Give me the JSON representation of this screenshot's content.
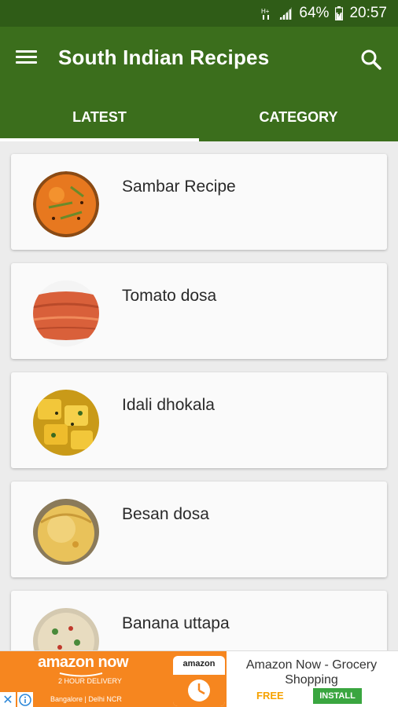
{
  "status_bar": {
    "battery": "64%",
    "time": "20:57"
  },
  "app": {
    "title": "South Indian Recipes"
  },
  "tabs": [
    {
      "label": "LATEST",
      "active": true
    },
    {
      "label": "CATEGORY",
      "active": false
    }
  ],
  "recipes": [
    {
      "name": "Sambar Recipe",
      "image": "sambar"
    },
    {
      "name": "Tomato dosa",
      "image": "tomato-dosa"
    },
    {
      "name": "Idali dhokala",
      "image": "idli-dhokla"
    },
    {
      "name": "Besan dosa",
      "image": "besan-dosa"
    },
    {
      "name": "Banana uttapa",
      "image": "banana-uttapam"
    }
  ],
  "ad": {
    "brand": "amazon now",
    "tagline": "2 HOUR DELIVERY",
    "cities": "Bangalore | Delhi NCR",
    "icon_label": "amazon",
    "title": "Amazon Now - Grocery Shopping",
    "price": "FREE",
    "install_label": "INSTALL"
  },
  "colors": {
    "primary": "#3b6e1c",
    "status_bar": "#2f5c17",
    "ad_orange": "#f6861f",
    "install_green": "#3aa640"
  }
}
